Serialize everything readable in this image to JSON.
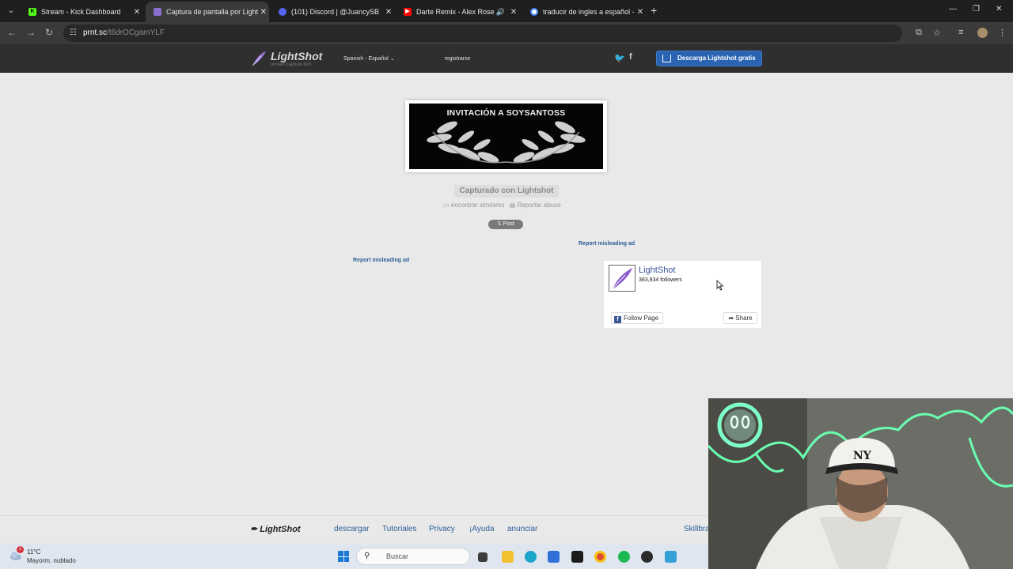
{
  "browser": {
    "tabs": [
      {
        "title": "Stream - Kick Dashboard",
        "favicon": "kick-icon",
        "color": "#53fc18",
        "active": false
      },
      {
        "title": "Captura de pantalla por Lightsh",
        "favicon": "lightshot-icon",
        "color": "#8a6fd1",
        "active": true
      },
      {
        "title": "(101) Discord | @JuancySB",
        "favicon": "discord-icon",
        "color": "#5865f2",
        "active": false,
        "badge": "101"
      },
      {
        "title": "Darte Remix - Alex Rose Ft.",
        "favicon": "youtube-icon",
        "color": "#ff0000",
        "active": false
      },
      {
        "title": "traducir de ingles a español - B",
        "favicon": "google-icon",
        "color": "#4285f4",
        "active": false
      }
    ],
    "url_host": "prnt.sc",
    "url_path": "/t6drOCgamYLF"
  },
  "lightshot": {
    "logo": "LightShot",
    "logo_subtitle": "screen capture tool",
    "language": "Spanish - Español",
    "register": "registrarse",
    "download_button": "Descarga Lightshot gratis",
    "image_title": "INVITACIÓN A SOYSANTOSS",
    "captured_label": "Capturado con Lightshot",
    "find_similar": "encontrar similares",
    "report_abuse": "Reportar abuso",
    "post_button": "Post",
    "post_glyph": "𝕏",
    "report_ad_1": "Report misleading ad",
    "report_ad_2": "Report misleading ad"
  },
  "fb_widget": {
    "page_name": "LightShot",
    "followers": "383,834 followers",
    "follow_label": "Follow Page",
    "share_label": "Share",
    "fb_glyph": "f"
  },
  "footer": {
    "logo": "LightShot",
    "links": [
      "descargar",
      "Tutoriales",
      "Privacy",
      "¡Ayuda",
      "anunciar",
      "Skillbra"
    ]
  },
  "taskbar": {
    "temperature": "11°C",
    "weather": "Mayorm. nublado",
    "weather_badge": "1",
    "search_label": "Buscar"
  },
  "colors": {
    "download_blue": "#2a63b1",
    "link_blue": "#2b5f96",
    "fb_blue": "#3b5998"
  }
}
